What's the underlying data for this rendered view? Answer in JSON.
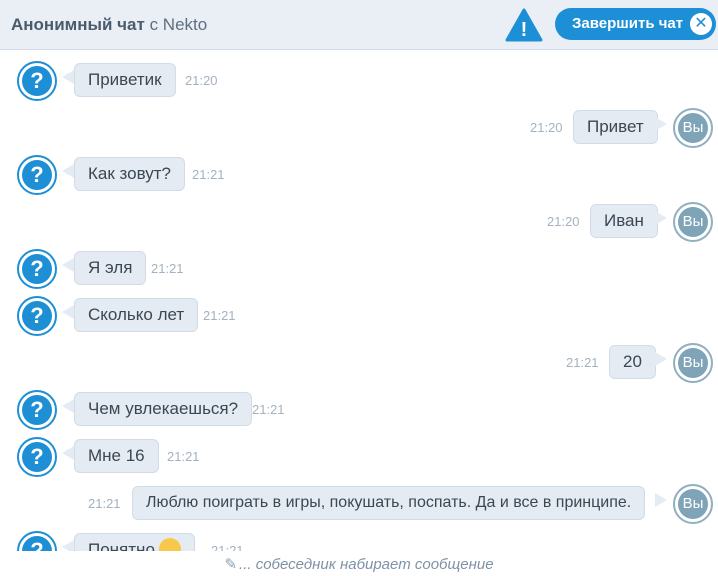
{
  "header": {
    "title_bold": "Анонимный чат",
    "title_rest": "с Nekto",
    "end_button_label": "Завершить чат",
    "end_button_close": "✕",
    "warning_symbol": "!"
  },
  "avatar": {
    "stranger": "?",
    "me": "Вы"
  },
  "messages": [
    {
      "from": "stranger",
      "text": "Приветик",
      "time": "21:20"
    },
    {
      "from": "me",
      "text": "Привет",
      "time": "21:20"
    },
    {
      "from": "stranger",
      "text": "Как зовут?",
      "time": "21:21"
    },
    {
      "from": "me",
      "text": "Иван",
      "time": "21:20"
    },
    {
      "from": "stranger",
      "text": "Я эля",
      "time": "21:21"
    },
    {
      "from": "stranger",
      "text": "Сколько лет",
      "time": "21:21"
    },
    {
      "from": "me",
      "text": "20",
      "time": "21:21"
    },
    {
      "from": "stranger",
      "text": "Чем увлекаешься?",
      "time": "21:21"
    },
    {
      "from": "stranger",
      "text": "Мне 16",
      "time": "21:21"
    },
    {
      "from": "me",
      "text": "Люблю поиграть в игры, покушать, поспать. Да и все в принципе.",
      "time": "21:21"
    },
    {
      "from": "stranger",
      "text": "Понятно",
      "time": "21:21"
    }
  ],
  "typing_indicator": "... собеседник набирает сообщение",
  "colors": {
    "accent": "#1d8fd6",
    "header_bg": "#e9eff5",
    "bubble_bg": "#e4ebf2",
    "me_avatar": "#7fa4b8"
  }
}
